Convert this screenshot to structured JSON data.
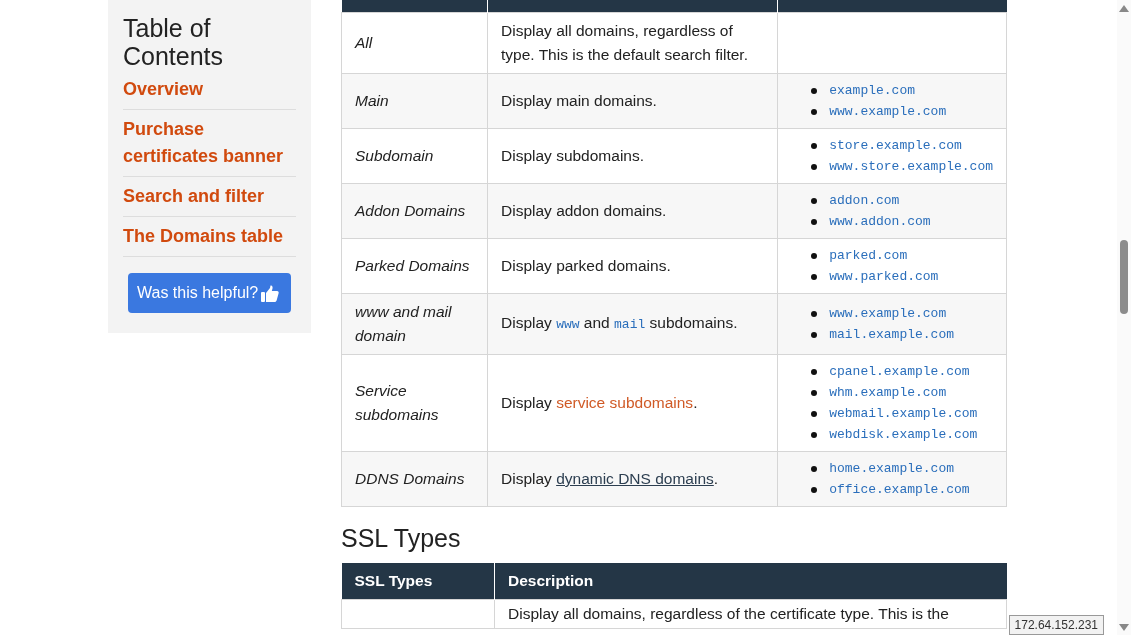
{
  "sidebar": {
    "title": "Table of Contents",
    "items": [
      {
        "label": "Overview"
      },
      {
        "label": "Purchase certificates banner"
      },
      {
        "label": "Search and filter"
      },
      {
        "label": "The Domains table"
      }
    ],
    "helpful_button": "Was this helpful?"
  },
  "domain_types": {
    "rows": [
      {
        "type": "All",
        "description": [
          {
            "kind": "text",
            "text": "Display all domains, regardless of type. This is the default search filter."
          }
        ]
      },
      {
        "type": "Main",
        "description": [
          {
            "kind": "text",
            "text": "Display main domains."
          }
        ],
        "examples": [
          "example.com",
          "www.example.com"
        ]
      },
      {
        "type": "Subdomain",
        "description": [
          {
            "kind": "text",
            "text": "Display subdomains."
          }
        ],
        "examples": [
          "store.example.com",
          "www.store.example.com"
        ]
      },
      {
        "type": "Addon Domains",
        "description": [
          {
            "kind": "text",
            "text": "Display addon domains."
          }
        ],
        "examples": [
          "addon.com",
          "www.addon.com"
        ]
      },
      {
        "type": "Parked Domains",
        "description": [
          {
            "kind": "text",
            "text": "Display parked domains."
          }
        ],
        "examples": [
          "parked.com",
          "www.parked.com"
        ]
      },
      {
        "type": "www and mail domain",
        "description": [
          {
            "kind": "text",
            "text": "Display "
          },
          {
            "kind": "code",
            "text": "www"
          },
          {
            "kind": "text",
            "text": " and "
          },
          {
            "kind": "code",
            "text": "mail"
          },
          {
            "kind": "text",
            "text": " subdomains."
          }
        ],
        "examples": [
          "www.example.com",
          "mail.example.com"
        ]
      },
      {
        "type": "Service subdomains",
        "description": [
          {
            "kind": "text",
            "text": "Display "
          },
          {
            "kind": "link",
            "text": "service subdomains"
          },
          {
            "kind": "text",
            "text": "."
          }
        ],
        "examples": [
          "cpanel.example.com",
          "whm.example.com",
          "webmail.example.com",
          "webdisk.example.com"
        ]
      },
      {
        "type": "DDNS Domains",
        "description": [
          {
            "kind": "text",
            "text": "Display "
          },
          {
            "kind": "underlined-link",
            "text": "dynamic DNS domains"
          },
          {
            "kind": "text",
            "text": "."
          }
        ],
        "examples": [
          "home.example.com",
          "office.example.com"
        ]
      }
    ]
  },
  "ssl_section": {
    "heading": "SSL Types",
    "columns": [
      "SSL Types",
      "Description"
    ],
    "rows": [
      {
        "description": "Display all domains, regardless of the certificate type. This is the"
      }
    ]
  },
  "ip_tooltip": "172.64.152.231"
}
